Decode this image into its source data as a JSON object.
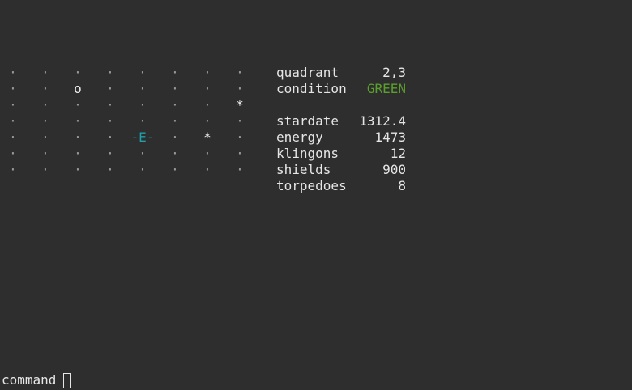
{
  "sector_grid": [
    [
      ".",
      ".",
      ".",
      ".",
      ".",
      ".",
      ".",
      "."
    ],
    [
      ".",
      ".",
      "o",
      ".",
      ".",
      ".",
      ".",
      "."
    ],
    [
      ".",
      ".",
      ".",
      ".",
      ".",
      ".",
      ".",
      "*"
    ],
    [
      ".",
      ".",
      ".",
      ".",
      ".",
      ".",
      ".",
      "."
    ],
    [
      ".",
      ".",
      ".",
      ".",
      "-E-",
      ".",
      "*",
      "."
    ],
    [
      ".",
      ".",
      ".",
      ".",
      ".",
      ".",
      ".",
      "."
    ],
    [
      ".",
      ".",
      ".",
      ".",
      ".",
      ".",
      ".",
      "."
    ]
  ],
  "status": {
    "quadrant_label": "quadrant",
    "quadrant_value": "2,3",
    "condition_label": "condition",
    "condition_value": "GREEN",
    "stardate_label": "stardate",
    "stardate_value": "1312.4",
    "energy_label": "energy",
    "energy_value": "1473",
    "klingons_label": "klingons",
    "klingons_value": "12",
    "shields_label": "shields",
    "shields_value": "900",
    "torpedoes_label": "torpedoes",
    "torpedoes_value": "8"
  },
  "colors": {
    "background": "#2e2e2e",
    "text": "#e6e6e6",
    "condition_green": "#5aa02c",
    "enterprise": "#1ea0a8",
    "empty_cell": "#9a9a9a"
  },
  "command": {
    "prompt": "command"
  }
}
